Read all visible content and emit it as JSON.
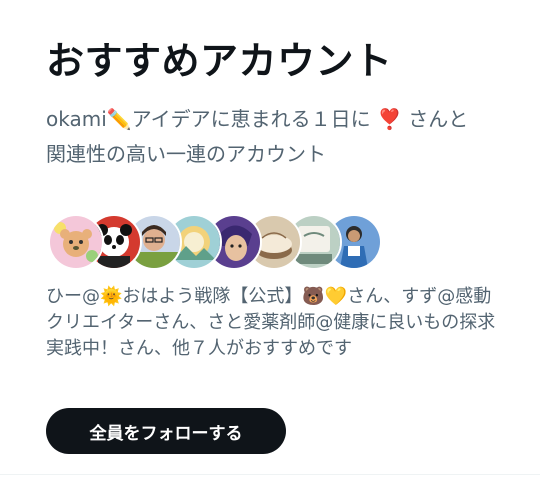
{
  "card": {
    "title": "おすすめアカウント",
    "subtitle": "okami✏️アイデアに恵まれる１日に ❣️ さんと関連性の高い一連のアカウント",
    "avatars": [
      {
        "name": "avatar-bear-flowers",
        "color": "#f4c7d9",
        "accent": "#e8b07a"
      },
      {
        "name": "avatar-panda",
        "color": "#d43a2f",
        "accent": "#ffffff"
      },
      {
        "name": "avatar-person-glasses",
        "color": "#c9d6e8",
        "accent": "#e0b090"
      },
      {
        "name": "avatar-illustration",
        "color": "#9fd0d6",
        "accent": "#f2d27a"
      },
      {
        "name": "avatar-character-purple",
        "color": "#5a3f8f",
        "accent": "#e7c1a0"
      },
      {
        "name": "avatar-cake",
        "color": "#d9c9ae",
        "accent": "#8a6a4a"
      },
      {
        "name": "avatar-sign",
        "color": "#bcd0c4",
        "accent": "#6f8a7c"
      },
      {
        "name": "avatar-person-blue",
        "color": "#6fa0d8",
        "accent": "#2c2c2c"
      }
    ],
    "followers_text": "ひー@🌞おはよう戦隊【公式】🐻💛さん、すず@感動クリエイターさん、さと愛薬剤師@健康に良いもの探求実践中！さん、他７人がおすすめです",
    "follow_all_label": "全員をフォローする"
  }
}
